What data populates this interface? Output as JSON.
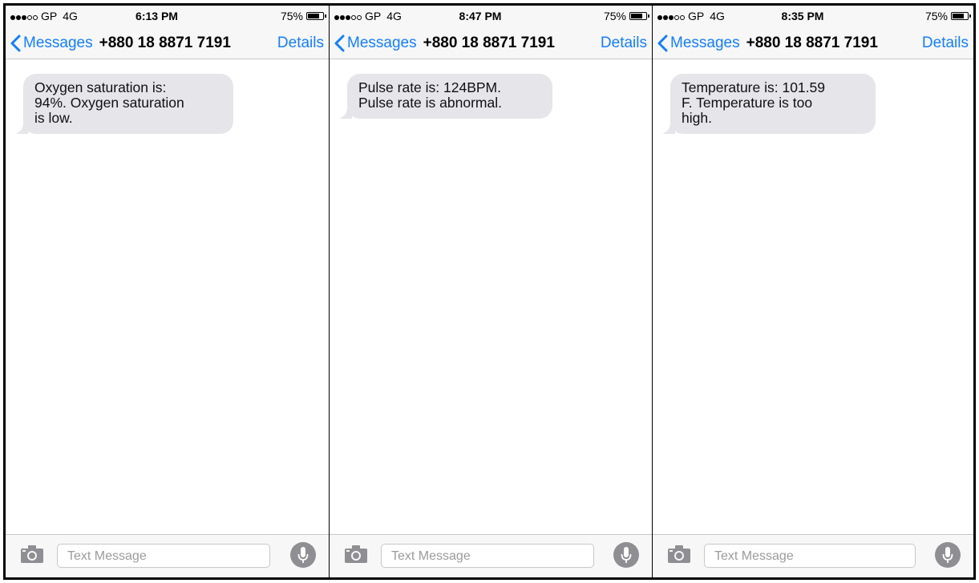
{
  "phones": [
    {
      "status": {
        "carrier": "GP",
        "network": "4G",
        "time": "6:13 PM",
        "battery": "75%",
        "battery_level": 0.75
      },
      "nav": {
        "back_label": "Messages",
        "contact": "+880 18 8871 7191",
        "details": "Details"
      },
      "message": {
        "lines": [
          "Oxygen saturation is:",
          "94%. Oxygen saturation",
          "is low."
        ]
      },
      "input": {
        "placeholder": "Text Message"
      }
    },
    {
      "status": {
        "carrier": "GP",
        "network": "4G",
        "time": "8:47 PM",
        "battery": "75%",
        "battery_level": 0.75
      },
      "nav": {
        "back_label": "Messages",
        "contact": "+880 18 8871 7191",
        "details": "Details"
      },
      "message": {
        "lines": [
          "Pulse rate is: 124BPM.",
          "Pulse rate is abnormal."
        ]
      },
      "input": {
        "placeholder": "Text Message"
      }
    },
    {
      "status": {
        "carrier": "GP",
        "network": "4G",
        "time": "8:35 PM",
        "battery": "75%",
        "battery_level": 0.75
      },
      "nav": {
        "back_label": "Messages",
        "contact": "+880 18 8871 7191",
        "details": "Details"
      },
      "message": {
        "lines": [
          "Temperature is: 101.59",
          "F. Temperature is too",
          "high."
        ]
      },
      "input": {
        "placeholder": "Text Message"
      }
    }
  ],
  "icons": {
    "signal": "signal-dots-icon",
    "battery": "battery-icon",
    "back": "chevron-left-icon",
    "camera": "camera-icon",
    "mic": "microphone-icon"
  },
  "colors": {
    "accent": "#147efb",
    "bubble": "#e5e5ea",
    "bar_bg": "#f7f7f8",
    "mic_bg": "#8e8e93"
  }
}
